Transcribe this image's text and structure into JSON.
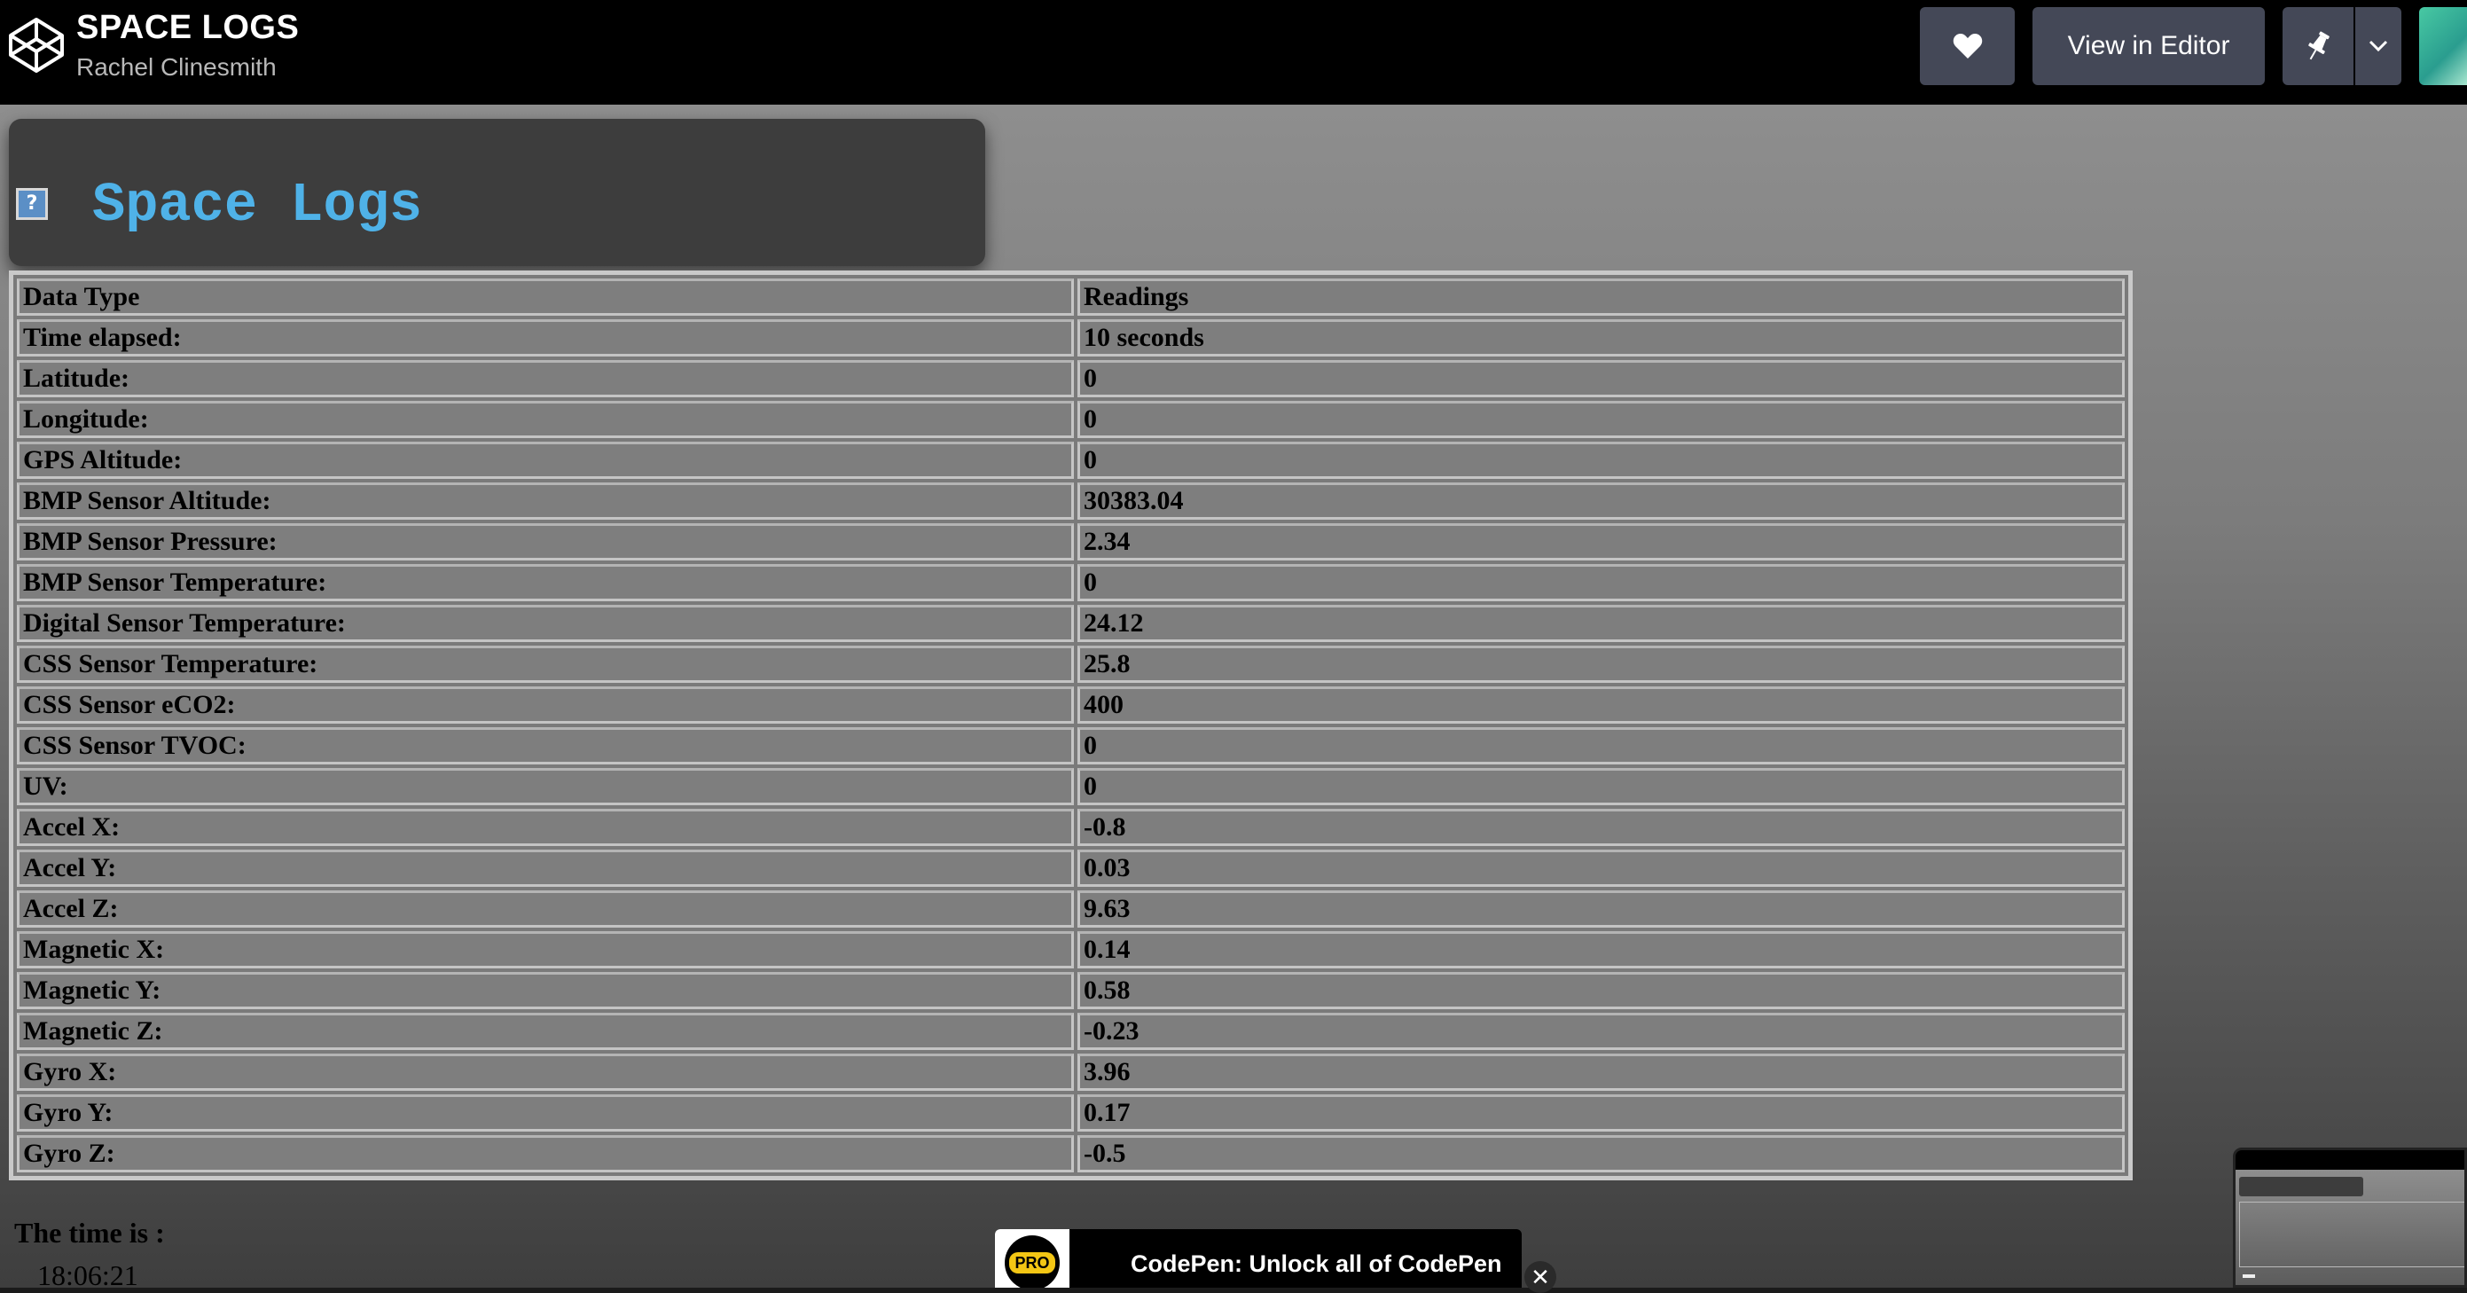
{
  "header": {
    "title": "SPACE LOGS",
    "author": "Rachel Clinesmith",
    "view_in_editor_label": "View in Editor",
    "icons": [
      "codepen-logo-icon",
      "heart-icon",
      "pin-icon",
      "chevron-down-icon"
    ]
  },
  "page": {
    "heading": "Space Logs",
    "broken_image_glyph": "?",
    "table": {
      "headers": [
        "Data Type",
        "Readings"
      ],
      "rows": [
        {
          "label": "Time elapsed:",
          "value": "10 seconds"
        },
        {
          "label": "Latitude:",
          "value": "0"
        },
        {
          "label": "Longitude:",
          "value": "0"
        },
        {
          "label": "GPS Altitude:",
          "value": "0"
        },
        {
          "label": "BMP Sensor Altitude:",
          "value": "30383.04"
        },
        {
          "label": "BMP Sensor Pressure:",
          "value": "2.34"
        },
        {
          "label": "BMP Sensor Temperature:",
          "value": "0"
        },
        {
          "label": "Digital Sensor Temperature:",
          "value": "24.12"
        },
        {
          "label": "CSS Sensor Temperature:",
          "value": "25.8"
        },
        {
          "label": "CSS Sensor eCO2:",
          "value": "400"
        },
        {
          "label": "CSS Sensor TVOC:",
          "value": "0"
        },
        {
          "label": "UV:",
          "value": "0"
        },
        {
          "label": "Accel X:",
          "value": "-0.8"
        },
        {
          "label": "Accel Y:",
          "value": "0.03"
        },
        {
          "label": "Accel Z:",
          "value": "9.63"
        },
        {
          "label": "Magnetic X:",
          "value": "0.14"
        },
        {
          "label": "Magnetic Y:",
          "value": "0.58"
        },
        {
          "label": "Magnetic Z:",
          "value": "-0.23"
        },
        {
          "label": "Gyro X:",
          "value": "3.96"
        },
        {
          "label": "Gyro Y:",
          "value": "0.17"
        },
        {
          "label": "Gyro Z:",
          "value": "-0.5"
        }
      ]
    },
    "time_label": "The time is :",
    "time_value": "18:06:21"
  },
  "promo": {
    "badge": "PRO",
    "text": "CodePen: Unlock all of CodePen",
    "close_glyph": "✕"
  },
  "colors": {
    "header_bg": "#000000",
    "button_bg": "#444857",
    "title_accent": "#4fb2e8",
    "pro_yellow": "#f3c614"
  }
}
